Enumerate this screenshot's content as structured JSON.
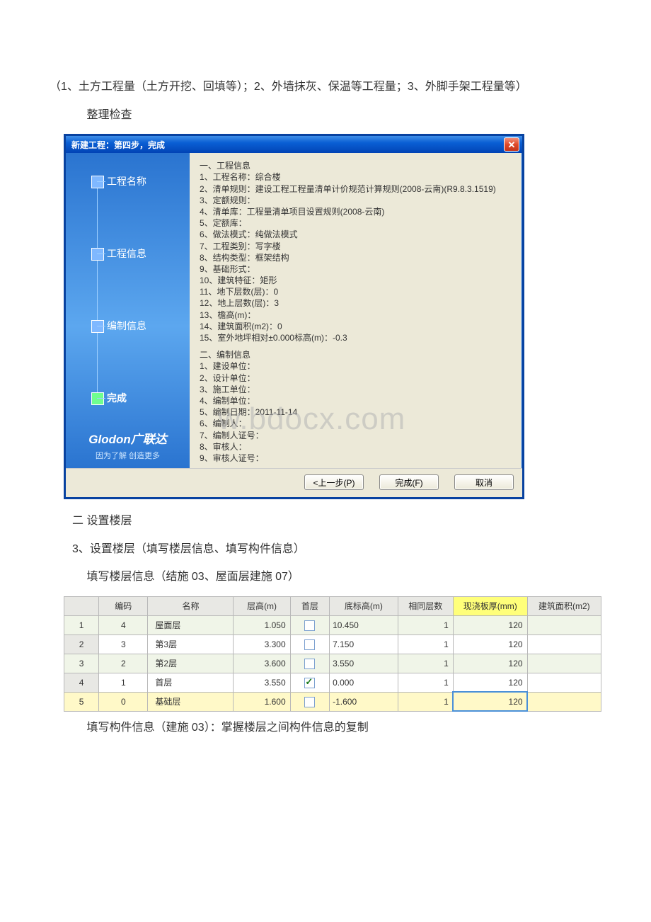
{
  "doc": {
    "p1": "（1、土方工程量（土方开挖、回填等）；2、外墙抹灰、保温等工程量；3、外脚手架工程量等）",
    "p2": " 整理检查",
    "p3": "二 设置楼层",
    "p4": "3、设置楼层（填写楼层信息、填写构件信息）",
    "p5": " 填写楼层信息（结施 03、屋面层建施 07）",
    "p6": " 填写构件信息（建施 03）：掌握楼层之间构件信息的复制"
  },
  "dialog": {
    "title": "新建工程：第四步，完成",
    "close_label": "✕",
    "watermark": "w.bdocx.com",
    "steps": {
      "s1": "工程名称",
      "s2": "工程信息",
      "s3": "编制信息",
      "s4": "完成"
    },
    "branding": {
      "name": "Glodon广联达",
      "slogan": "因为了解 创造更多"
    },
    "info": {
      "section1_title": "一、工程信息",
      "l1": "1、工程名称：综合楼",
      "l2": "2、清单规则：建设工程工程量清单计价规范计算规则(2008-云南)(R9.8.3.1519)",
      "l3": "3、定额规则：",
      "l4": "4、清单库：工程量清单项目设置规则(2008-云南)",
      "l5": "5、定额库：",
      "l6": "6、做法模式：纯做法模式",
      "l7": "7、工程类别：写字楼",
      "l8": "8、结构类型：框架结构",
      "l9": "9、基础形式：",
      "l10": "10、建筑特征：矩形",
      "l11": "11、地下层数(层)：0",
      "l12": "12、地上层数(层)：3",
      "l13": "13、檐高(m)：",
      "l14": "14、建筑面积(m2)：0",
      "l15": "15、室外地坪相对±0.000标高(m)：-0.3",
      "section2_title": "二、编制信息",
      "m1": "1、建设单位：",
      "m2": "2、设计单位：",
      "m3": "3、施工单位：",
      "m4": "4、编制单位：",
      "m5": "5、编制日期：2011-11-14",
      "m6": "6、编制人：",
      "m7": "7、编制人证号：",
      "m8": "8、审核人：",
      "m9": "9、审核人证号："
    },
    "buttons": {
      "prev": "<上一步(P)",
      "finish": "完成(F)",
      "cancel": "取消"
    }
  },
  "floor_table": {
    "headers": {
      "h0": "",
      "h1": "编码",
      "h2": "名称",
      "h3": "层高(m)",
      "h4": "首层",
      "h5": "底标高(m)",
      "h6": "相同层数",
      "h7": "现浇板厚(mm)",
      "h8": "建筑面积(m2)"
    },
    "rows": [
      {
        "idx": "1",
        "code": "4",
        "name": "屋面层",
        "height": "1.050",
        "first": false,
        "bottom": "10.450",
        "same": "1",
        "slab": "120",
        "area": ""
      },
      {
        "idx": "2",
        "code": "3",
        "name": "第3层",
        "height": "3.300",
        "first": false,
        "bottom": "7.150",
        "same": "1",
        "slab": "120",
        "area": ""
      },
      {
        "idx": "3",
        "code": "2",
        "name": "第2层",
        "height": "3.600",
        "first": false,
        "bottom": "3.550",
        "same": "1",
        "slab": "120",
        "area": ""
      },
      {
        "idx": "4",
        "code": "1",
        "name": "首层",
        "height": "3.550",
        "first": true,
        "bottom": "0.000",
        "same": "1",
        "slab": "120",
        "area": ""
      },
      {
        "idx": "5",
        "code": "0",
        "name": "基础层",
        "height": "1.600",
        "first": false,
        "bottom": "-1.600",
        "same": "1",
        "slab": "120",
        "area": ""
      }
    ]
  }
}
